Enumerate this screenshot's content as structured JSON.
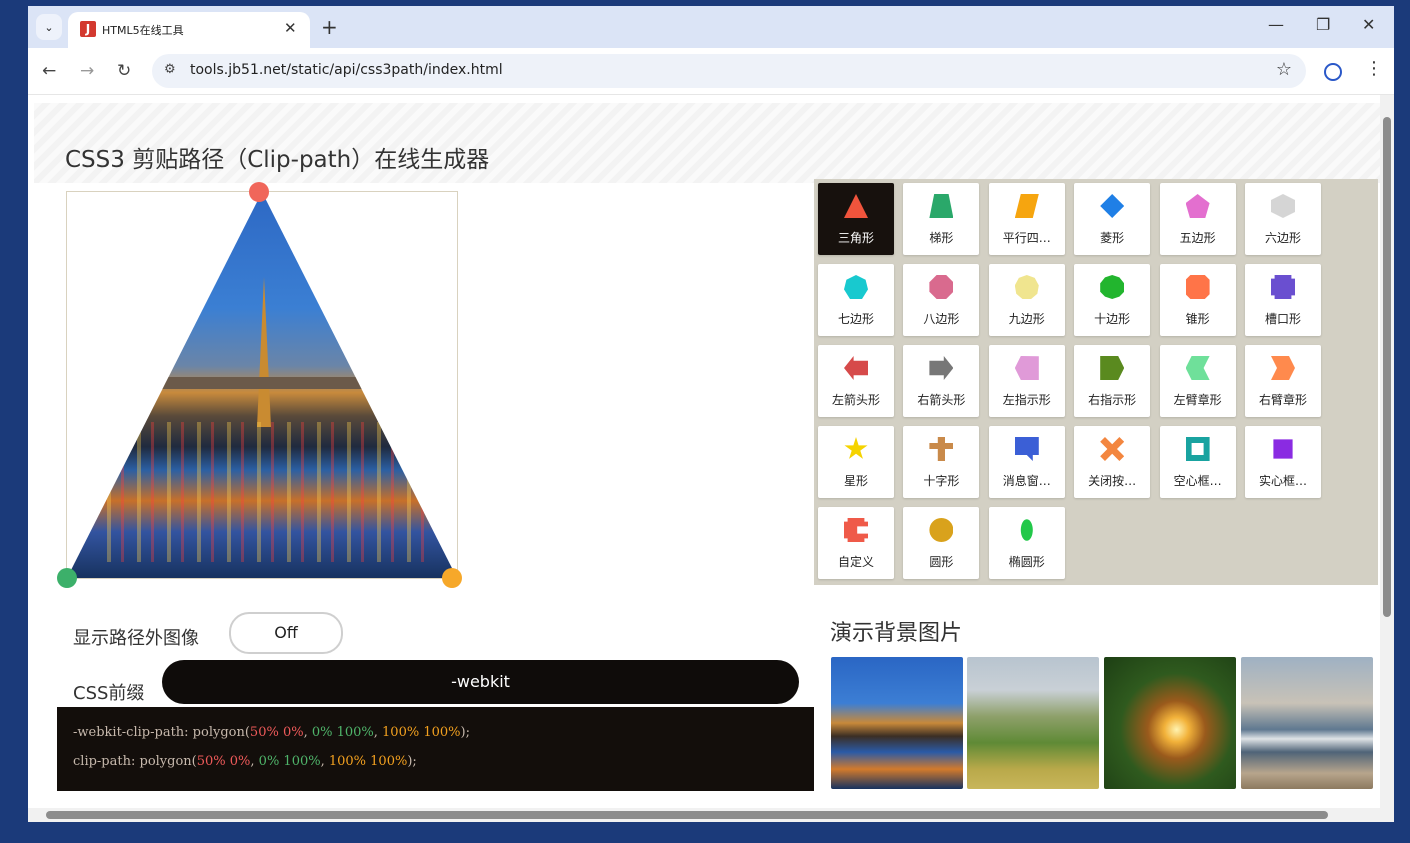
{
  "browser": {
    "tab_title": "HTML5在线工具",
    "tab_close": "✕",
    "new_tab": "+",
    "url": "tools.jb51.net/static/api/css3path/index.html",
    "minimize": "—",
    "restore": "❐",
    "close": "✕"
  },
  "page": {
    "heading": "CSS3 剪贴路径（Clip-path）在线生成器",
    "toggle_label": "显示路径外图像",
    "toggle_value": "Off",
    "prefix_label": "CSS前缀",
    "prefix_value": "-webkit",
    "code": {
      "line1_prefix": "-webkit-clip-path: polygon(",
      "line2_prefix": "clip-path: polygon(",
      "p1": "50% 0%",
      "p2": "0% 100%",
      "p3": "100% 100%",
      "sep": ", ",
      "end": ");"
    },
    "bg_title": "演示背景图片"
  },
  "shapes": [
    {
      "label": "三角形",
      "color": "#f0543c",
      "clip": "polygon(50% 0%,0% 100%,100% 100%)",
      "active": true
    },
    {
      "label": "梯形",
      "color": "#2aa86a",
      "clip": "polygon(20% 0%,80% 0%,100% 100%,0% 100%)"
    },
    {
      "label": "平行四…",
      "color": "#f6a50f",
      "clip": "polygon(25% 0%,100% 0%,75% 100%,0% 100%)"
    },
    {
      "label": "菱形",
      "color": "#1f7fe6",
      "clip": "polygon(50% 0%,100% 50%,50% 100%,0% 50%)"
    },
    {
      "label": "五边形",
      "color": "#e36fcf",
      "clip": "polygon(50% 0%,100% 38%,82% 100%,18% 100%,0% 38%)"
    },
    {
      "label": "六边形",
      "color": "#d5d5d5",
      "clip": "polygon(50% 0%,100% 25%,100% 75%,50% 100%,0% 75%,0% 25%)"
    },
    {
      "label": "七边形",
      "color": "#18c9cf",
      "clip": "polygon(50% 0%,90% 20%,100% 60%,75% 100%,25% 100%,0% 60%,10% 20%)"
    },
    {
      "label": "八边形",
      "color": "#d96a8e",
      "clip": "polygon(30% 0%,70% 0%,100% 30%,100% 70%,70% 100%,30% 100%,0% 70%,0% 30%)"
    },
    {
      "label": "九边形",
      "color": "#f0e58f",
      "clip": "polygon(50% 0%,83% 12%,100% 43%,94% 78%,68% 100%,32% 100%,6% 78%,0% 43%,17% 12%)"
    },
    {
      "label": "十边形",
      "color": "#22b52e",
      "clip": "polygon(50% 0%,80% 10%,100% 35%,100% 70%,80% 90%,50% 100%,20% 90%,0% 70%,0% 35%,20% 10%)"
    },
    {
      "label": "锥形",
      "color": "#ff7448",
      "clip": "polygon(20% 0%,80% 0%,100% 20%,100% 80%,80% 100%,20% 100%,0% 80%,0% 20%)"
    },
    {
      "label": "槽口形",
      "color": "#6a4fd0",
      "clip": "polygon(0% 15%,15% 15%,15% 0%,85% 0%,85% 15%,100% 15%,100% 85%,85% 85%,85% 100%,15% 100%,15% 85%,0% 85%)"
    },
    {
      "label": "左箭头形",
      "color": "#d64a4a",
      "clip": "polygon(40% 0%,40% 20%,100% 20%,100% 80%,40% 80%,40% 100%,0% 50%)"
    },
    {
      "label": "右箭头形",
      "color": "#777777",
      "clip": "polygon(0% 20%,60% 20%,60% 0%,100% 50%,60% 100%,60% 80%,0% 80%)"
    },
    {
      "label": "左指示形",
      "color": "#e09ad8",
      "clip": "polygon(25% 0%,100% 1%,100% 100%,25% 100%,0% 50%)"
    },
    {
      "label": "右指示形",
      "color": "#5a8a1f",
      "clip": "polygon(0% 0%,75% 0%,100% 50%,75% 100%,0% 100%)"
    },
    {
      "label": "左臂章形",
      "color": "#6fe09a",
      "clip": "polygon(100% 0%,75% 50%,100% 100%,25% 100%,0% 50%,25% 0%)"
    },
    {
      "label": "右臂章形",
      "color": "#ff8a4d",
      "clip": "polygon(75% 0%,100% 50%,75% 100%,0% 100%,25% 50%,0% 0%)"
    },
    {
      "label": "星形",
      "color": "#f5d300",
      "clip": "polygon(50% 0%,61% 35%,98% 35%,68% 57%,79% 91%,50% 70%,21% 91%,32% 57%,2% 35%,39% 35%)"
    },
    {
      "label": "十字形",
      "color": "#c98a4a",
      "clip": "polygon(35% 0%,65% 0%,65% 25%,100% 25%,100% 50%,65% 50%,65% 100%,35% 100%,35% 50%,0% 50%,0% 25%,35% 25%)"
    },
    {
      "label": "消息窗…",
      "color": "#3b5fd6",
      "clip": "polygon(0% 0%,100% 0%,100% 75%,75% 75%,75% 100%,50% 75%,0% 75%)"
    },
    {
      "label": "关闭按…",
      "color": "#f3863f",
      "clip": "polygon(20% 0%,0% 20%,30% 50%,0% 80%,20% 100%,50% 70%,80% 100%,100% 80%,70% 50%,100% 20%,80% 0%,50% 30%)"
    },
    {
      "label": "空心框…",
      "color": "#19a3a0",
      "clip": "polygon(0% 0%,0% 100%,25% 100%,25% 25%,75% 25%,75% 75%,25% 75%,25% 100%,100% 100%,100% 0%)"
    },
    {
      "label": "实心框…",
      "color": "#8a2be2",
      "clip": "polygon(10% 10%,90% 10%,90% 90%,10% 90%)"
    },
    {
      "label": "自定义",
      "color": "#ef5a49",
      "clip": "polygon(0% 15%,15% 15%,15% 0%,85% 0%,85% 15%,100% 15%,100% 35%,55% 35%,55% 65%,100% 65%,100% 85%,85% 85%,85% 100%,15% 100%,15% 85%,0% 85%)"
    },
    {
      "label": "圆形",
      "color": "#d9a21c",
      "clip": "circle(50% at 50% 50%)"
    },
    {
      "label": "椭圆形",
      "color": "#22c84a",
      "clip": "ellipse(25% 45% at 50% 50%)"
    }
  ],
  "handles": [
    {
      "color": "#f0665a"
    },
    {
      "color": "#3cb06a"
    },
    {
      "color": "#f6a82a"
    }
  ],
  "thumbnails": [
    {
      "name": "bridge"
    },
    {
      "name": "hills"
    },
    {
      "name": "sparkler"
    },
    {
      "name": "sea"
    }
  ]
}
